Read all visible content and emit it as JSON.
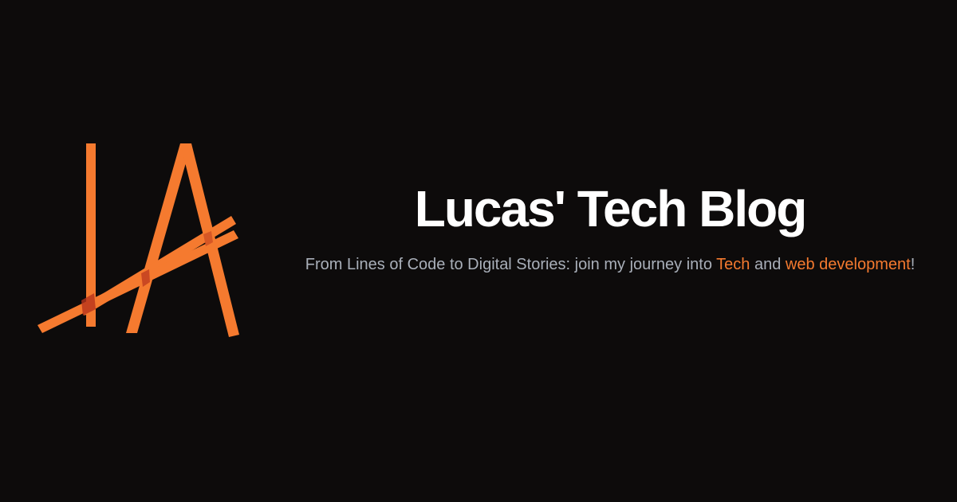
{
  "colors": {
    "background": "#0d0b0b",
    "accent": "#f57a2f",
    "title": "#ffffff",
    "subtitle": "#a9afb9"
  },
  "logo": {
    "icon": "la-monogram-logo"
  },
  "header": {
    "title": "Lucas' Tech Blog"
  },
  "tagline": {
    "part1": "From Lines of Code to Digital Stories: join my journey into ",
    "highlight1": "Tech",
    "part2": " and ",
    "highlight2": "web development",
    "end": "!"
  }
}
